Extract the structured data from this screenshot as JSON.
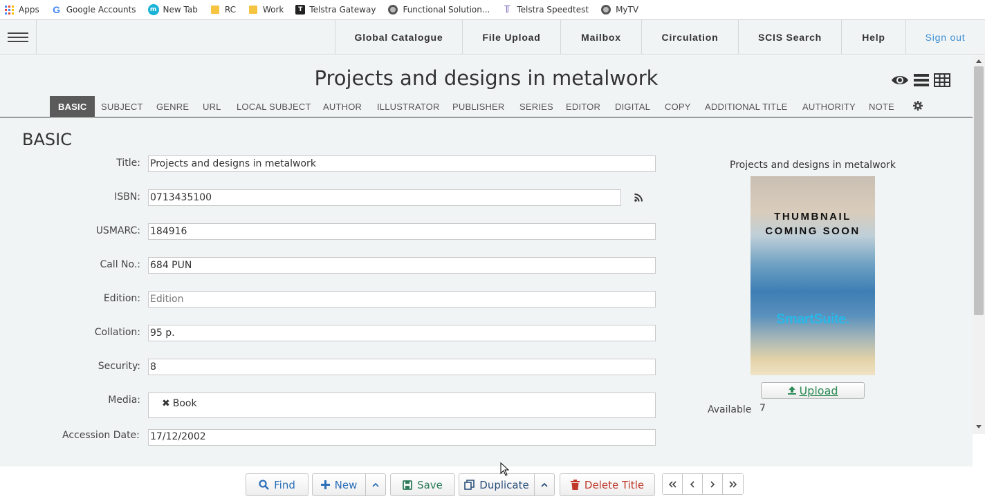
{
  "bookmarks": [
    {
      "label": "Apps",
      "icon": "apps-icon"
    },
    {
      "label": "Google Accounts",
      "icon": "google-icon"
    },
    {
      "label": "New Tab",
      "icon": "newtab-icon"
    },
    {
      "label": "RC",
      "icon": "folder-icon"
    },
    {
      "label": "Work",
      "icon": "folder-icon"
    },
    {
      "label": "Telstra Gateway",
      "icon": "telstra-icon"
    },
    {
      "label": "Functional Solution...",
      "icon": "globe-icon"
    },
    {
      "label": "Telstra Speedtest",
      "icon": "speedtest-icon"
    },
    {
      "label": "MyTV",
      "icon": "globe-icon"
    }
  ],
  "nav": {
    "global_catalogue": "Global Catalogue",
    "file_upload": "File Upload",
    "mailbox": "Mailbox",
    "circulation": "Circulation",
    "scis_search": "SCIS Search",
    "help": "Help",
    "sign_out": "Sign out"
  },
  "page": {
    "title": "Projects and designs in metalwork"
  },
  "tabs": [
    "BASIC",
    "SUBJECT",
    "GENRE",
    "URL",
    "LOCAL SUBJECT",
    "AUTHOR",
    "ILLUSTRATOR",
    "PUBLISHER",
    "SERIES",
    "EDITOR",
    "DIGITAL",
    "COPY",
    "ADDITIONAL TITLE",
    "AUTHORITY",
    "NOTE"
  ],
  "section": {
    "title": "BASIC"
  },
  "form": {
    "title_label": "Title:",
    "title_value": "Projects and designs in metalwork",
    "isbn_label": "ISBN:",
    "isbn_value": "0713435100",
    "usmarc_label": "USMARC:",
    "usmarc_value": "184916",
    "callno_label": "Call No.:",
    "callno_value": "684 PUN",
    "edition_label": "Edition:",
    "edition_value": "",
    "edition_placeholder": "Edition",
    "collation_label": "Collation:",
    "collation_value": "95 p.",
    "security_label": "Security:",
    "security_value": "8",
    "media_label": "Media:",
    "media_tag": "Book",
    "accession_label": "Accession Date:",
    "accession_value": "17/12/2002"
  },
  "thumbnail": {
    "caption": "Projects and designs in metalwork",
    "line1": "THUMBNAIL",
    "line2": "COMING SOON",
    "brand": "SmartSuite.",
    "upload_label": "Upload",
    "available_label": "Available",
    "available_value": "7"
  },
  "toolbar": {
    "find": "Find",
    "new": "New",
    "save": "Save",
    "duplicate": "Duplicate",
    "delete": "Delete Title"
  },
  "colors": {
    "nav_bg": "#f1f4f4",
    "active_tab": "#5a5a5a",
    "link_blue": "#3a8fd6",
    "delete_red": "#c0392b",
    "upload_green": "#2e8b57"
  }
}
